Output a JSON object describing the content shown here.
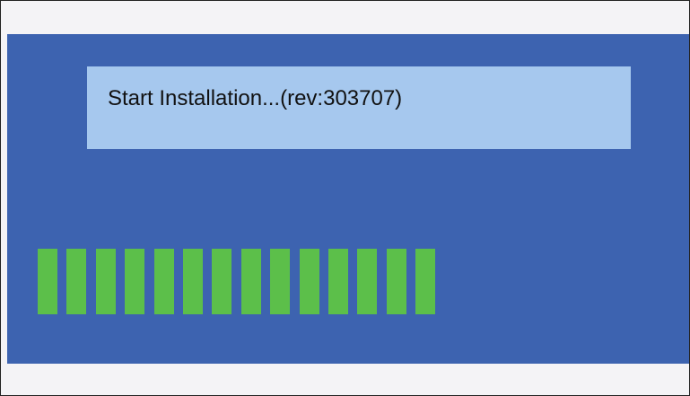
{
  "installer": {
    "status_text": "Start Installation...(rev:303707)",
    "progress": {
      "filled_segments": 14,
      "segment_color": "#5cbf4a"
    }
  },
  "colors": {
    "frame_background": "#f4f3f6",
    "panel_background": "#3d63b0",
    "status_box_background": "#a6c8ee",
    "progress_fill": "#5cbf4a"
  }
}
